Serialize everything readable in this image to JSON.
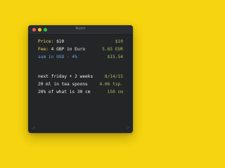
{
  "window": {
    "title": "Numi"
  },
  "lines": [
    {
      "tokens": [
        {
          "text": "Price: ",
          "color": "#f0d75c"
        },
        {
          "text": "$10",
          "color": "#eeeeee"
        }
      ],
      "result": "$10"
    },
    {
      "tokens": [
        {
          "text": "Fee: ",
          "color": "#f0d75c"
        },
        {
          "text": "4 GBP in Euro",
          "color": "#eeeeee"
        }
      ],
      "result": "5.65 EUR"
    },
    {
      "tokens": [
        {
          "text": "sum in USD - 4%",
          "color": "#68a8e6"
        }
      ],
      "result": "$15.54"
    },
    {
      "tokens": [
        {
          "text": "next friday + 2 weeks",
          "color": "#eeeeee"
        }
      ],
      "result": "8/14/15"
    },
    {
      "tokens": [
        {
          "text": "20 ml in tea spoons",
          "color": "#eeeeee"
        }
      ],
      "result": "4.06 tsp."
    },
    {
      "tokens": [
        {
          "text": "20% of what is 30 cm",
          "color": "#eeeeee"
        }
      ],
      "result": "150 cm"
    }
  ],
  "footer": {
    "left_icon": "history-icon",
    "right_icon": "share-icon"
  },
  "colors": {
    "background": "#f6d410",
    "window": "#242527",
    "result": "#9bc55a"
  }
}
